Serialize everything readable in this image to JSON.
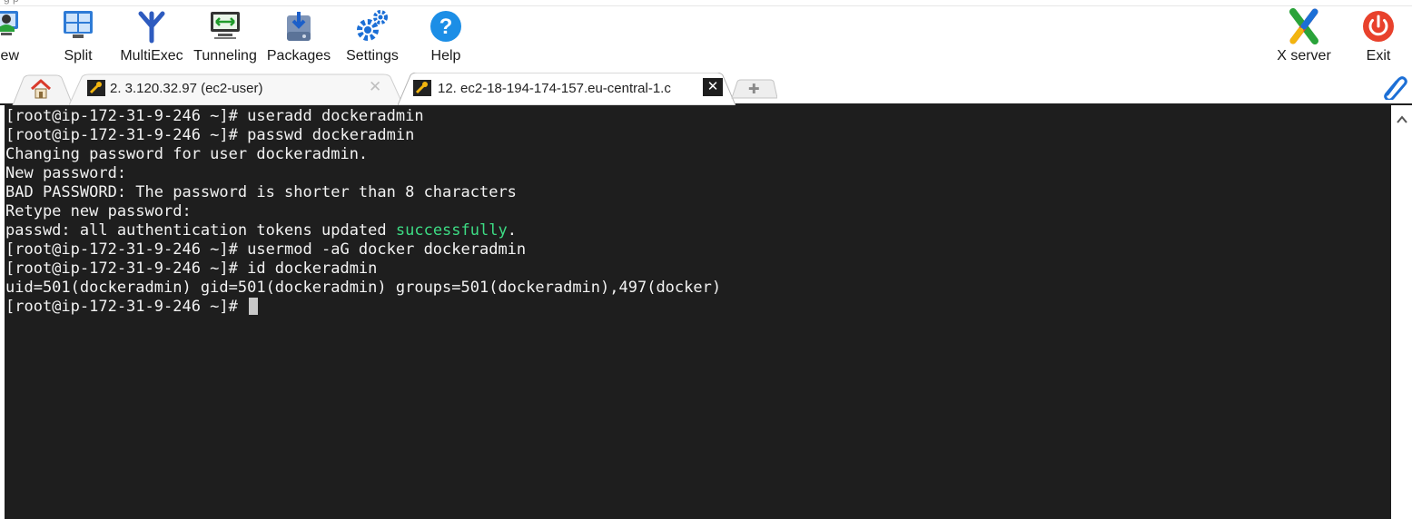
{
  "window": {
    "title_fragment": "g                    p"
  },
  "toolbar": {
    "items": [
      {
        "label": "iew"
      },
      {
        "label": "Split"
      },
      {
        "label": "MultiExec"
      },
      {
        "label": "Tunneling"
      },
      {
        "label": "Packages"
      },
      {
        "label": "Settings"
      },
      {
        "label": "Help"
      }
    ],
    "right_items": [
      {
        "label": "X server"
      },
      {
        "label": "Exit"
      }
    ]
  },
  "tabs": [
    {
      "label": "2. 3.120.32.97 (ec2-user)",
      "active": false
    },
    {
      "label": "12. ec2-18-194-174-157.eu-central-1.c",
      "active": true
    }
  ],
  "terminal": {
    "lines": [
      "[root@ip-172-31-9-246 ~]# useradd dockeradmin",
      "[root@ip-172-31-9-246 ~]# passwd dockeradmin",
      "Changing password for user dockeradmin.",
      "New password:",
      "BAD PASSWORD: The password is shorter than 8 characters",
      "Retype new password:"
    ],
    "success_line": {
      "prefix": "passwd: all authentication tokens updated ",
      "highlight": "successfully",
      "suffix": "."
    },
    "lines_after": [
      "[root@ip-172-31-9-246 ~]# usermod -aG docker dockeradmin",
      "[root@ip-172-31-9-246 ~]# id dockeradmin",
      "uid=501(dockeradmin) gid=501(dockeradmin) groups=501(dockeradmin),497(docker)"
    ],
    "prompt": "[root@ip-172-31-9-246 ~]# "
  },
  "colors": {
    "terminal_bg": "#1e1e1e",
    "terminal_fg": "#f2f2f2",
    "success": "#3ddc84",
    "help_blue": "#1c8ee6",
    "exit_red": "#e8412c"
  },
  "icons": [
    "session-view-icon",
    "split-icon",
    "multiexec-icon",
    "tunneling-icon",
    "packages-icon",
    "settings-icon",
    "help-icon",
    "xserver-icon",
    "exit-icon",
    "home-icon",
    "terminal-key-icon",
    "new-tab-icon",
    "attach-icon",
    "scroll-up-arrow-icon"
  ]
}
